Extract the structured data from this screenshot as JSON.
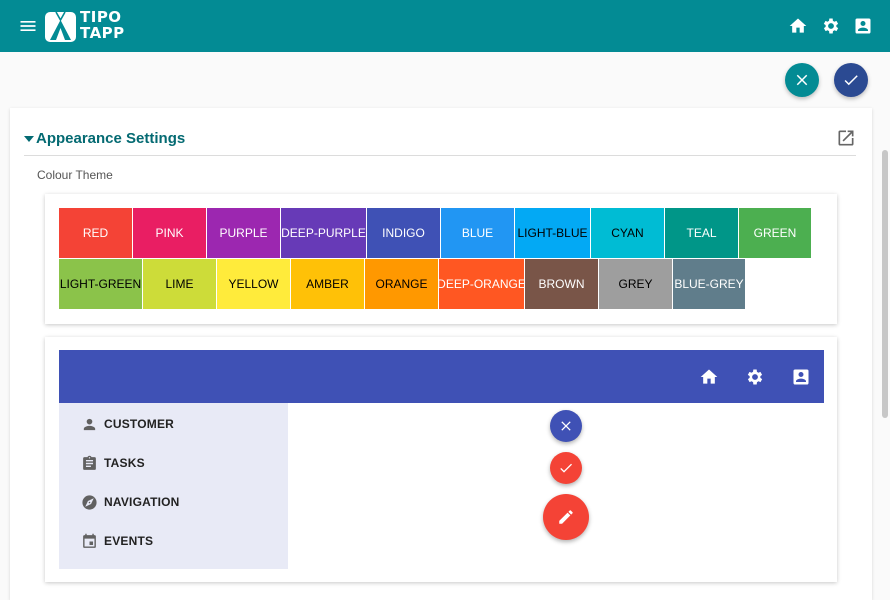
{
  "app": {
    "brand_line1": "TIPO",
    "brand_line2": "TAPP",
    "bar_color": "#038b94",
    "icons": [
      "menu-icon",
      "home-icon",
      "settings-icon",
      "account-box-icon"
    ]
  },
  "actions": {
    "cancel_icon": "close-icon",
    "cancel_color": "#038b94",
    "save_icon": "check-icon",
    "save_color": "#2b4a92"
  },
  "section": {
    "title": "Appearance Settings",
    "field_label": "Colour Theme",
    "popout_icon": "open-in-new-icon"
  },
  "themes": {
    "row1": [
      {
        "label": "RED",
        "color": "#f44336",
        "text": "#ffffff"
      },
      {
        "label": "PINK",
        "color": "#e91e63",
        "text": "#ffffff"
      },
      {
        "label": "PURPLE",
        "color": "#9c27b0",
        "text": "#ffffff"
      },
      {
        "label": "DEEP-PURPLE",
        "color": "#673ab7",
        "text": "#ffffff"
      },
      {
        "label": "INDIGO",
        "color": "#3f51b5",
        "text": "#ffffff"
      },
      {
        "label": "BLUE",
        "color": "#2196f3",
        "text": "#ffffff"
      },
      {
        "label": "LIGHT-BLUE",
        "color": "#03a9f4",
        "text": "#000000"
      },
      {
        "label": "CYAN",
        "color": "#00bcd4",
        "text": "#000000"
      },
      {
        "label": "TEAL",
        "color": "#009688",
        "text": "#ffffff"
      },
      {
        "label": "GREEN",
        "color": "#4caf50",
        "text": "#ffffff"
      }
    ],
    "row2": [
      {
        "label": "LIGHT-GREEN",
        "color": "#8bc34a",
        "text": "#000000"
      },
      {
        "label": "LIME",
        "color": "#cddc39",
        "text": "#000000"
      },
      {
        "label": "YELLOW",
        "color": "#ffeb3b",
        "text": "#000000"
      },
      {
        "label": "AMBER",
        "color": "#ffc107",
        "text": "#000000"
      },
      {
        "label": "ORANGE",
        "color": "#ff9800",
        "text": "#000000"
      },
      {
        "label": "DEEP-ORANGE",
        "color": "#ff5722",
        "text": "#ffffff"
      },
      {
        "label": "BROWN",
        "color": "#795548",
        "text": "#ffffff"
      },
      {
        "label": "GREY",
        "color": "#9e9e9e",
        "text": "#000000"
      },
      {
        "label": "BLUE-GREY",
        "color": "#607d8b",
        "text": "#ffffff"
      }
    ]
  },
  "preview": {
    "primary_color": "#3f51b5",
    "accent_color": "#f44336",
    "sidebar_color": "#e8eaf6",
    "nav": [
      {
        "label": "CUSTOMER",
        "icon": "person-icon"
      },
      {
        "label": "TASKS",
        "icon": "clipboard-icon"
      },
      {
        "label": "NAVIGATION",
        "icon": "compass-icon"
      },
      {
        "label": "EVENTS",
        "icon": "calendar-icon"
      }
    ],
    "fab_icons": [
      "close-icon",
      "check-icon",
      "edit-icon"
    ]
  }
}
